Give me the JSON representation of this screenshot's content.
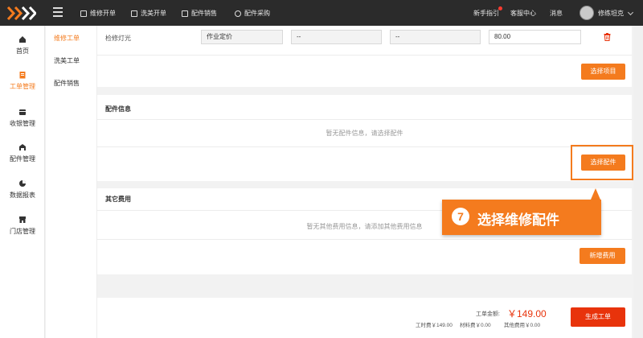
{
  "colors": {
    "accent": "#f47b1e",
    "topbar": "#2b2b2b",
    "danger": "#e8330b",
    "notify": "#ff3b30"
  },
  "topbar": {
    "nav": [
      {
        "label": "维修开单",
        "icon": "clipboard-icon"
      },
      {
        "label": "洗美开单",
        "icon": "clipboard-icon"
      },
      {
        "label": "配件销售",
        "icon": "clipboard-icon"
      },
      {
        "label": "配件采购",
        "icon": "plus-circle-icon"
      }
    ],
    "guide": "新手指引",
    "help": "客服中心",
    "messages": "消息",
    "user": "修练坦克"
  },
  "sidebar": {
    "items": [
      {
        "label": "首页",
        "icon": "home-icon"
      },
      {
        "label": "工单管理",
        "icon": "clipboard-icon"
      },
      {
        "label": "收银管理",
        "icon": "wallet-icon"
      },
      {
        "label": "配件管理",
        "icon": "warehouse-icon"
      },
      {
        "label": "数据报表",
        "icon": "pie-chart-icon"
      },
      {
        "label": "门店管理",
        "icon": "store-icon"
      }
    ]
  },
  "subnav": {
    "items": [
      "维修工单",
      "洗美工单",
      "配件销售"
    ]
  },
  "project_row": {
    "name": "检修灯光",
    "type": "作业定价",
    "col3": "--",
    "col4": "--",
    "price": "80.00"
  },
  "projects": {
    "select_button": "选择项目"
  },
  "parts": {
    "title": "配件信息",
    "empty": "暂无配件信息，请选择配件",
    "select_button": "选择配件"
  },
  "other_fees": {
    "title": "其它费用",
    "empty": "暂无其他费用信息，请添加其他费用信息",
    "add_button": "新增费用"
  },
  "callout": {
    "number": "7",
    "text": "选择维修配件"
  },
  "summary": {
    "total_label": "工单金额:",
    "total_value": "￥149.00",
    "labor": "工时费￥149.00",
    "material": "材料费￥0.00",
    "other": "其他费用￥0.00",
    "create_button": "生成工单"
  }
}
